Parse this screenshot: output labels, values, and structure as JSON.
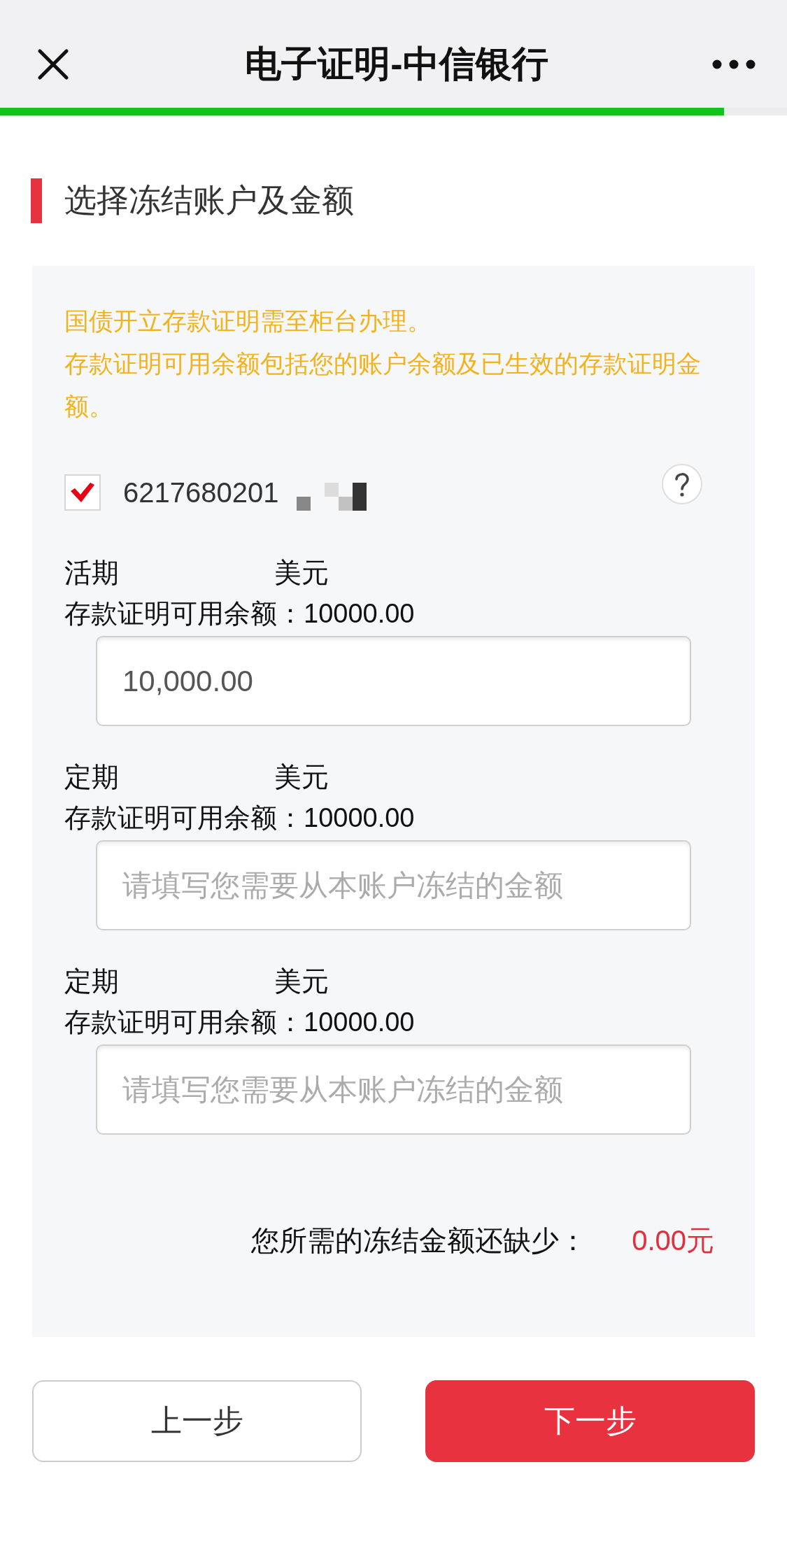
{
  "header": {
    "title": "电子证明-中信银行"
  },
  "progress": {
    "level": 0.92
  },
  "section": {
    "title": "选择冻结账户及金额"
  },
  "notice": [
    "国债开立存款证明需至柜台办理。",
    "存款证明可用余额包括您的账户余额及已生效的存款证明金额。"
  ],
  "account": {
    "number": "6217680201",
    "checked": true
  },
  "deposits": [
    {
      "type": "活期",
      "currency": "美元",
      "balance": "存款证明可用余额：10000.00",
      "input": {
        "value": "10,000.00"
      }
    },
    {
      "type": "定期",
      "currency": "美元",
      "balance": "存款证明可用余额：10000.00",
      "input": {
        "placeholder": "请填写您需要从本账户冻结的金额"
      }
    },
    {
      "type": "定期",
      "currency": "美元",
      "balance": "存款证明可用余额：10000.00",
      "input": {
        "placeholder": "请填写您需要从本账户冻结的金额"
      }
    }
  ],
  "shortfall": {
    "label": "您所需的冻结金额还缺少：",
    "value": "0.00元"
  },
  "buttons": [
    {
      "label": "上一步",
      "kind": "secondary"
    },
    {
      "label": "下一步",
      "kind": "primary"
    }
  ]
}
